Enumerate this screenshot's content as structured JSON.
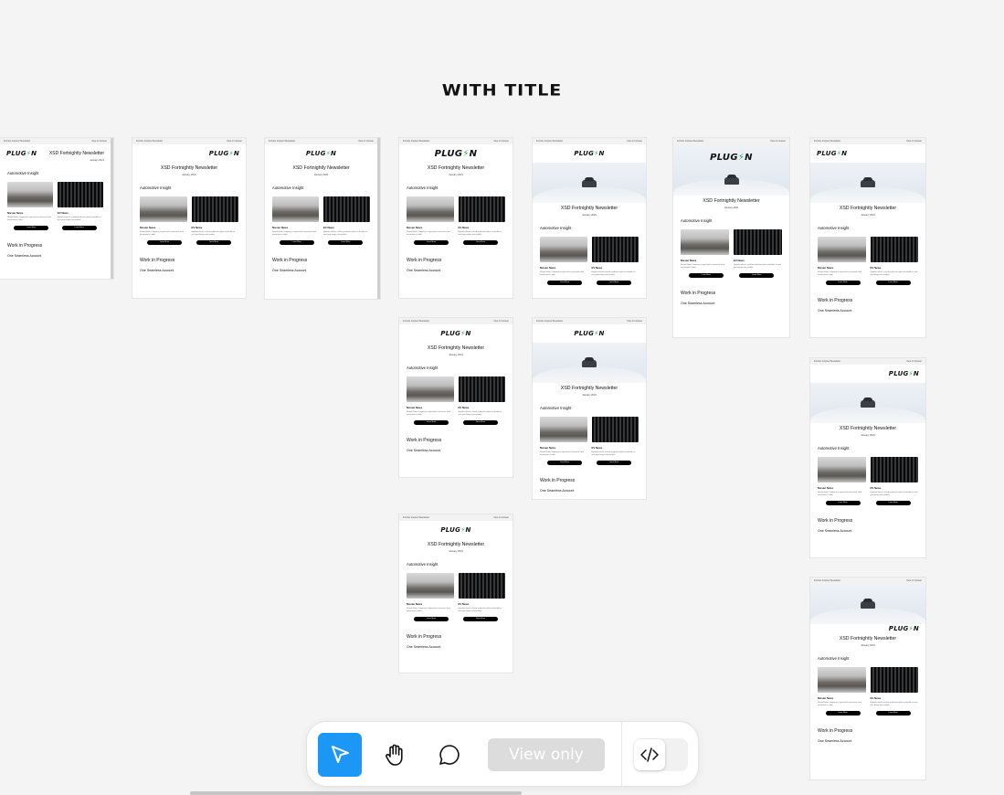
{
  "section_title": "WITH TITLE",
  "colors": {
    "accent": "#1c97f5",
    "brand_green": "#22b04b"
  },
  "email": {
    "preheader_left": "Fortnite Inspired Newsletter",
    "preheader_right": "View in browser",
    "logo_text": "PLUG",
    "logo_bolt": "⚡",
    "logo_tail": "N",
    "title": "XSD Fortnightly Newsletter",
    "date": "January 2021",
    "section": "Automotive Insight",
    "col1_caption": "Nissan News",
    "col1_text": "Nissan Motor Company is expected to announce fresh investment in India",
    "col2_caption": "EV News",
    "col2_text": "Hyundai electric vehicle production plans to double as next year brings new models",
    "button": "Learn More",
    "wip": "Work in Progress",
    "account": "One Seamless Account"
  },
  "toolbar": {
    "tools": [
      {
        "name": "pointer-tool",
        "icon": "cursor-icon",
        "active": true
      },
      {
        "name": "hand-tool",
        "icon": "hand-icon",
        "active": false
      },
      {
        "name": "comment-tool",
        "icon": "comment-bubble-icon",
        "active": false
      }
    ],
    "view_only_label": "View only",
    "code_toggle_icon": "code-icon"
  }
}
